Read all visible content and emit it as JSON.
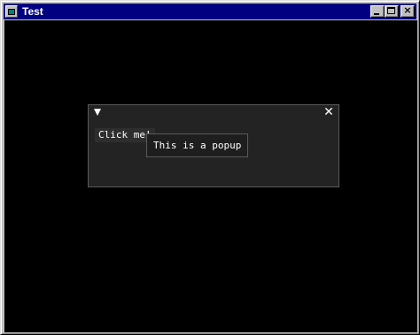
{
  "window": {
    "title": "Test",
    "icon": "app-window-icon",
    "controls": {
      "minimize_icon": "minimize-icon",
      "maximize_icon": "maximize-icon",
      "close_icon": "close-icon",
      "close_glyph": "×"
    }
  },
  "imgui_window": {
    "collapse_icon": "collapse-triangle-icon",
    "close_glyph": "✕",
    "button_label": "Click me!",
    "popup_text": "This is a popup"
  },
  "colors": {
    "titlebar": "#000080",
    "client_background": "#000000",
    "imgui_window_bg": "#232323",
    "imgui_border": "#5a5a5a",
    "text": "#ffffff"
  }
}
